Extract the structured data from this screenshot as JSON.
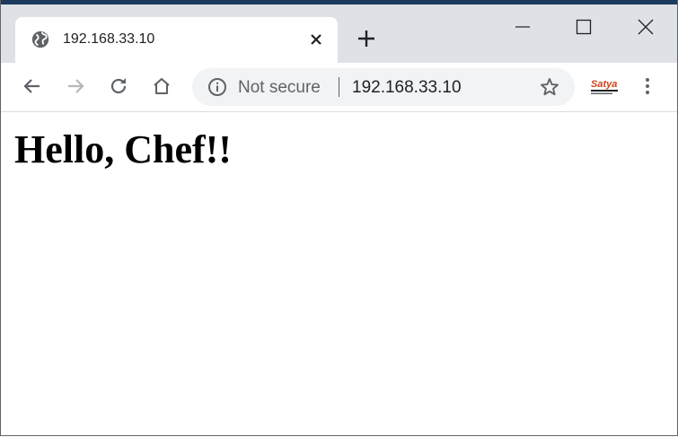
{
  "tab": {
    "title": "192.168.33.10",
    "favicon": "globe-icon"
  },
  "toolbar": {
    "security_label": "Not secure",
    "url": "192.168.33.10",
    "extension_label": "Satya"
  },
  "page": {
    "heading": "Hello, Chef!!"
  },
  "colors": {
    "titlebar": "#dee1e6",
    "omnibox": "#f1f3f4",
    "icon": "#5f6368",
    "icon_disabled": "#b5b7ba",
    "text": "#202124"
  }
}
